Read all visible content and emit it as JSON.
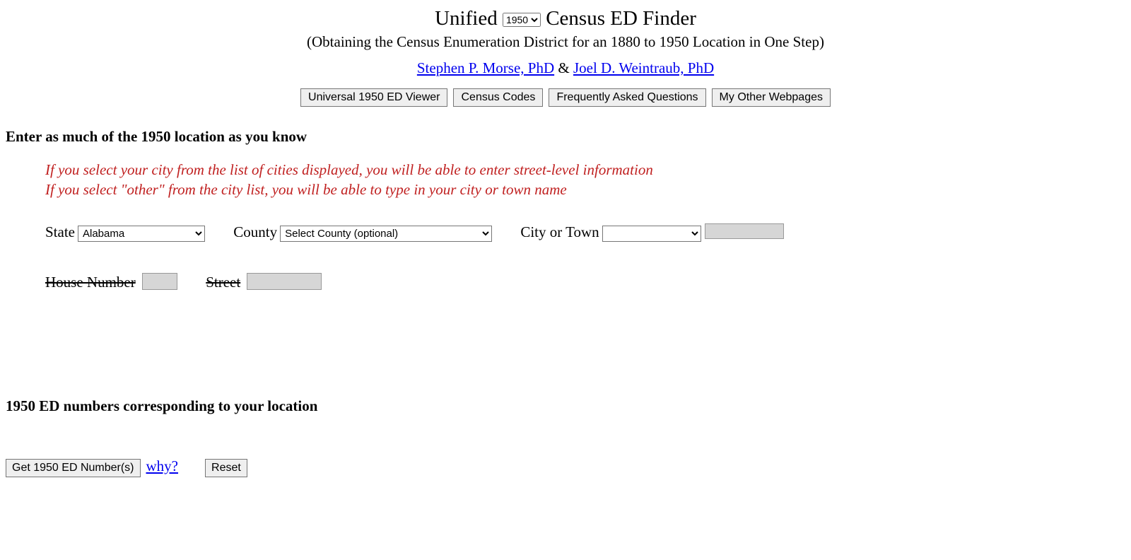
{
  "header": {
    "title_prefix": "Unified",
    "year_selected": "1950",
    "title_suffix": "Census ED Finder",
    "subtitle": "(Obtaining the Census Enumeration District for an 1880 to 1950 Location in One Step)"
  },
  "authors": {
    "author1": "Stephen P. Morse, PhD",
    "ampersand": "  &  ",
    "author2": "Joel D. Weintraub, PhD"
  },
  "buttons": {
    "viewer": "Universal 1950 ED Viewer",
    "codes": "Census Codes",
    "faq": "Frequently Asked Questions",
    "other": "My Other Webpages"
  },
  "section1_heading": "Enter as much of the 1950 location as you know",
  "hints": {
    "line1": "If you select your city from the list of cities displayed, you will be able to enter street-level information",
    "line2": "If you select \"other\" from the city list, you will be able to type in your city or town name"
  },
  "form": {
    "state_label": "State",
    "state_selected": "Alabama",
    "county_label": "County",
    "county_selected": "Select County (optional)",
    "city_label": "City or Town",
    "house_label": "House Number",
    "street_label": "Street"
  },
  "section2_heading": "1950 ED numbers corresponding to your location",
  "bottom": {
    "get_button": "Get 1950 ED Number(s)",
    "why_link": "why?",
    "reset_button": "Reset"
  }
}
